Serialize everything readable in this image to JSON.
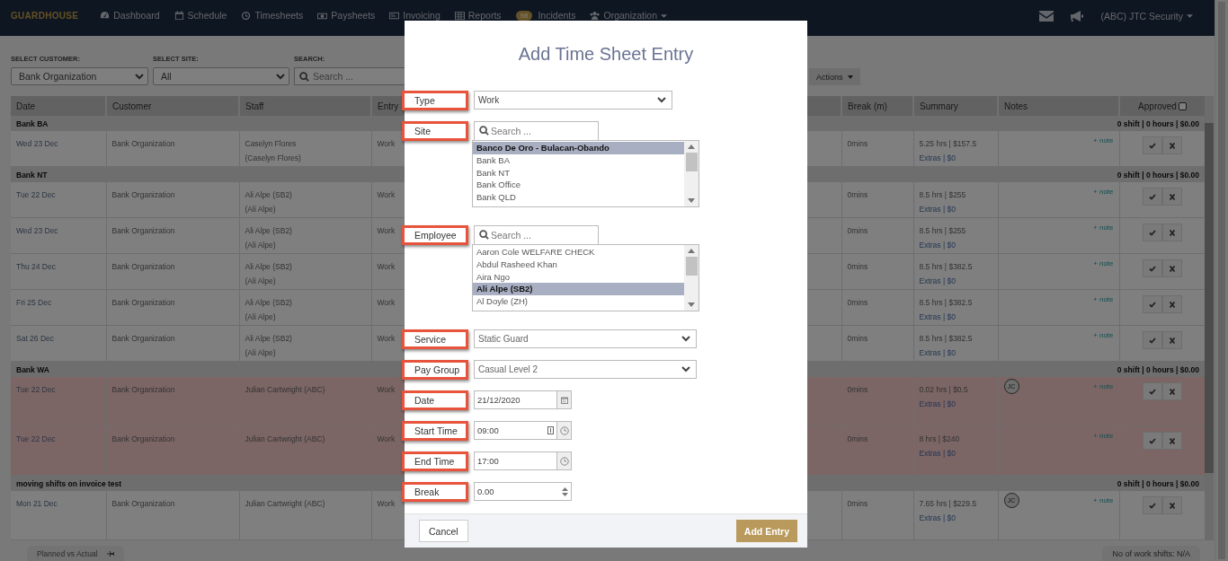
{
  "nav": {
    "logo": "GUARDHOUSE",
    "items": [
      {
        "label": "Dashboard"
      },
      {
        "label": "Schedule"
      },
      {
        "label": "Timesheets"
      },
      {
        "label": "Paysheets"
      },
      {
        "label": "Invoicing"
      },
      {
        "label": "Reports"
      },
      {
        "label": "Incidents",
        "badge": "98"
      },
      {
        "label": "Organization",
        "caret": true
      }
    ],
    "account": "(ABC) JTC Security"
  },
  "filters": {
    "customer_label": "SELECT CUSTOMER:",
    "customer": "Bank Organization",
    "site_label": "SELECT SITE:",
    "site": "All",
    "search_label": "SEARCH:",
    "search_placeholder": "Search ...",
    "actions": "Actions"
  },
  "table": {
    "columns": [
      "Date",
      "Customer",
      "Staff",
      "Entry",
      "Break (m)",
      "Summary",
      "Notes",
      "Approved"
    ],
    "approve_all_checked": false,
    "groups": [
      {
        "name": "Bank BA",
        "totals": "0 shift | 0 hours | $0.00",
        "rows": [
          {
            "date": "Wed 23 Dec",
            "customer": "Bank Organization",
            "staff": "Caselyn Flores",
            "staff_sub": "(Caselyn Flores)",
            "entry": "Work",
            "break": "0mins",
            "summary": "5.25 hrs | $157.5",
            "extras": "Extras | $0",
            "note": "+ note",
            "flagged": false
          }
        ]
      },
      {
        "name": "Bank NT",
        "totals": "0 shift | 0 hours | $0.00",
        "rows": [
          {
            "date": "Tue 22 Dec",
            "customer": "Bank Organization",
            "staff": "Ali Alpe (SB2)",
            "staff_sub": "(Ali Alpe)",
            "entry": "Work",
            "break": "0mins",
            "summary": "8.5 hrs | $255",
            "extras": "Extras | $0",
            "note": "+ note",
            "flagged": false
          },
          {
            "date": "Wed 23 Dec",
            "customer": "Bank Organization",
            "staff": "Ali Alpe (SB2)",
            "staff_sub": "(Ali Alpe)",
            "entry": "Work",
            "break": "0mins",
            "summary": "8.5 hrs | $255",
            "extras": "Extras | $0",
            "note": "+ note",
            "flagged": false
          },
          {
            "date": "Thu 24 Dec",
            "customer": "Bank Organization",
            "staff": "Ali Alpe (SB2)",
            "staff_sub": "(Ali Alpe)",
            "entry": "Work",
            "break": "0mins",
            "summary": "8.5 hrs | $382.5",
            "extras": "Extras | $0",
            "note": "+ note",
            "flagged": false
          },
          {
            "date": "Fri 25 Dec",
            "customer": "Bank Organization",
            "staff": "Ali Alpe (SB2)",
            "staff_sub": "(Ali Alpe)",
            "entry": "Work",
            "break": "0mins",
            "summary": "8.5 hrs | $382.5",
            "extras": "Extras | $0",
            "note": "+ note",
            "flagged": false
          },
          {
            "date": "Sat 26 Dec",
            "customer": "Bank Organization",
            "staff": "Ali Alpe (SB2)",
            "staff_sub": "(Ali Alpe)",
            "entry": "Work",
            "break": "0mins",
            "summary": "8.5 hrs | $382.5",
            "extras": "Extras | $0",
            "note": "+ note",
            "flagged": false
          }
        ]
      },
      {
        "name": "Bank WA",
        "totals": "0 shift | 0 hours | $0.00",
        "rows": [
          {
            "date": "Tue 22 Dec",
            "customer": "Bank Organization",
            "staff": "Julian Cartwright (ABC)",
            "entry": "Work",
            "break": "0mins",
            "summary": "0.02 hrs | $0.5",
            "extras": "Extras | $0",
            "avatar": "JC",
            "note": "+ note",
            "flagged": true
          },
          {
            "date": "Tue 22 Dec",
            "customer": "Bank Organization",
            "staff": "Julian Cartwright (ABC)",
            "entry": "Work",
            "break": "0mins",
            "summary": "8 hrs | $240",
            "extras": "Extras | $0",
            "note": "+ note",
            "flagged": true
          }
        ]
      },
      {
        "name": "moving shifts on invoice test",
        "totals": "0 shift | 0 hours | $0.00",
        "rows": [
          {
            "date": "Mon 21 Dec",
            "customer": "Bank Organization",
            "staff": "Julian Cartwright (ABC)",
            "entry": "Work",
            "break": "0mins",
            "summary": "7.65 hrs | $229.5",
            "extras": "Extras | $0",
            "avatar": "JC",
            "note": "+ note",
            "flagged": false
          }
        ]
      }
    ]
  },
  "footer": {
    "tab": "Planned vs Actual",
    "shift_count": "No of work shifts: N/A"
  },
  "modal": {
    "title": "Add Time Sheet Entry",
    "fields": [
      {
        "label": "Type",
        "kind": "select",
        "value": "Work"
      },
      {
        "label": "Site",
        "kind": "search-list",
        "placeholder": "Search ...",
        "options": [
          {
            "label": "Banco De Oro - Bulacan-Obando",
            "selected": true
          },
          {
            "label": "Bank BA",
            "selected": false
          },
          {
            "label": "Bank NT",
            "selected": false
          },
          {
            "label": "Bank Office",
            "selected": false
          },
          {
            "label": "Bank QLD",
            "selected": false
          }
        ]
      },
      {
        "label": "Employee",
        "kind": "search-list",
        "placeholder": "Search ...",
        "options": [
          {
            "label": "Aaron Cole WELFARE CHECK",
            "selected": false
          },
          {
            "label": "Abdul Rasheed Khan",
            "selected": false
          },
          {
            "label": "Aira Ngo",
            "selected": false
          },
          {
            "label": "Ali Alpe (SB2)",
            "selected": true
          },
          {
            "label": "Al Doyle (ZH)",
            "selected": false
          }
        ]
      },
      {
        "label": "Service",
        "kind": "select",
        "value": "Static Guard"
      },
      {
        "label": "Pay Group",
        "kind": "select",
        "value": "Casual Level 2"
      },
      {
        "label": "Date",
        "kind": "date",
        "value": "21/12/2020"
      },
      {
        "label": "Start Time",
        "kind": "time-stepper",
        "value": "09:00"
      },
      {
        "label": "End Time",
        "kind": "time",
        "value": "17:00"
      },
      {
        "label": "Break",
        "kind": "number",
        "value": "0.00"
      }
    ],
    "cancel": "Cancel",
    "submit": "Add Entry"
  }
}
